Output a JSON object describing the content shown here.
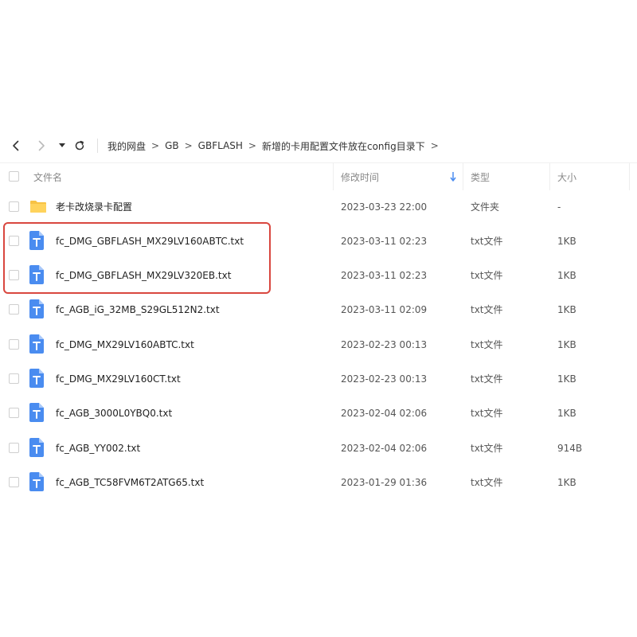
{
  "breadcrumb": [
    "我的网盘",
    "GB",
    "GBFLASH",
    "新增的卡用配置文件放在config目录下"
  ],
  "breadcrumb_separator": ">",
  "columns": {
    "name": "文件名",
    "modified": "修改时间",
    "type": "类型",
    "size": "大小"
  },
  "sort": {
    "column": "modified",
    "direction": "descending"
  },
  "colors": {
    "highlight": "#d9473f",
    "folder": "#f7c244",
    "file": "#4a8cf0"
  },
  "files": [
    {
      "icon": "folder-icon",
      "name": "老卡改烧录卡配置",
      "modified": "2023-03-23 22:00",
      "type": "文件夹",
      "size": "-"
    },
    {
      "icon": "txt-file-icon",
      "name": "fc_DMG_GBFLASH_MX29LV160ABTC.txt",
      "modified": "2023-03-11 02:23",
      "type": "txt文件",
      "size": "1KB",
      "highlighted": true
    },
    {
      "icon": "txt-file-icon",
      "name": "fc_DMG_GBFLASH_MX29LV320EB.txt",
      "modified": "2023-03-11 02:23",
      "type": "txt文件",
      "size": "1KB",
      "highlighted": true
    },
    {
      "icon": "txt-file-icon",
      "name": "fc_AGB_iG_32MB_S29GL512N2.txt",
      "modified": "2023-03-11 02:09",
      "type": "txt文件",
      "size": "1KB"
    },
    {
      "icon": "txt-file-icon",
      "name": "fc_DMG_MX29LV160ABTC.txt",
      "modified": "2023-02-23 00:13",
      "type": "txt文件",
      "size": "1KB"
    },
    {
      "icon": "txt-file-icon",
      "name": "fc_DMG_MX29LV160CT.txt",
      "modified": "2023-02-23 00:13",
      "type": "txt文件",
      "size": "1KB"
    },
    {
      "icon": "txt-file-icon",
      "name": "fc_AGB_3000L0YBQ0.txt",
      "modified": "2023-02-04 02:06",
      "type": "txt文件",
      "size": "1KB"
    },
    {
      "icon": "txt-file-icon",
      "name": "fc_AGB_YY002.txt",
      "modified": "2023-02-04 02:06",
      "type": "txt文件",
      "size": "914B"
    },
    {
      "icon": "txt-file-icon",
      "name": "fc_AGB_TC58FVM6T2ATG65.txt",
      "modified": "2023-01-29 01:36",
      "type": "txt文件",
      "size": "1KB"
    }
  ]
}
